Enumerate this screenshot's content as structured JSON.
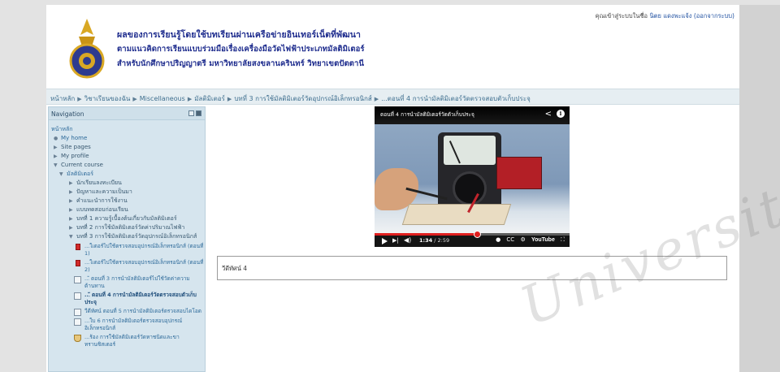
{
  "header": {
    "logo_label": "Prince of Songkla University",
    "title_line1": "ผลของการเรียนรู้โดยใช้บทเรียนผ่านเครือข่ายอินเทอร์เน็ตที่พัฒนา",
    "title_line2": "ตามแนวคิดการเรียนแบบร่วมมือเรื่องเครื่องมือวัดไฟฟ้าประเภทมัลติมิเตอร์",
    "title_line3": "สำหรับนักศึกษาปริญญาตรี มหาวิทยาลัยสงขลานครินทร์ วิทยาเขตปัตตานี",
    "login_prefix": "คุณเข้าสู่ระบบในชื่อ",
    "login_user": "นิตย แดงพะแจ้ง",
    "logout_label": "(ออกจากระบบ)"
  },
  "breadcrumb": {
    "items": [
      "หน้าหลัก",
      "วิชาเรียนของฉัน",
      "Miscellaneous",
      "มัลติมิเตอร์",
      "บทที่ 3 การใช้มัลติมิเตอร์วัดอุปกรณ์อิเล็กทรอนิกส์",
      "...ตอนที่ 4 การนำมัลติมิเตอร์วัดตรวจสอบตัวเก็บประจุ"
    ],
    "separator": "▶"
  },
  "sidebar": {
    "title": "Navigation",
    "home": "หน้าหลัก",
    "my_home": "My home",
    "site_pages": "Site pages",
    "my_profile": "My profile",
    "current_course": "Current course",
    "course_name": "มัลติมิเตอร์",
    "sections": [
      "นักเรียนลงทะเบียน",
      "ปัญหาและความเป็นมา",
      "คำแนะนำการใช้งาน",
      "แบบทดสอบก่อนเรียน",
      "บทที่ 1 ความรู้เบื้องต้นเกี่ยวกับมัลติมิเตอร์",
      "บทที่ 2 การใช้มัลติมิเตอร์วัดค่าปริมาณไฟฟ้า",
      "บทที่ 3 การใช้มัลติมิเตอร์วัดอุปกรณ์อิเล็กทรอนิกส์"
    ],
    "resources": [
      {
        "icon": "pdf-icon",
        "text": "...ใเตอร์ไปใช้ตรวจสอบอุปกรณ์อิเล็กทรอนิกส์ (ตอนที่ 1)",
        "bold": false
      },
      {
        "icon": "pdf-icon",
        "text": "...ใเตอร์ไปใช้ตรวจสอบอุปกรณ์อิเล็กทรอนิกส์ (ตอนที่ 2)",
        "bold": false
      },
      {
        "icon": "video-icon",
        "text": "...ั ตอนที่ 3 การนำมัลติมิเตอร์ไปใช้วัดค่าความต้านทาน",
        "bold": false
      },
      {
        "icon": "video-icon",
        "text": "...ั ตอนที่ 4 การนำมัลติมิเตอร์วัดตรวจสอบตัวเก็บประจุ",
        "bold": true
      },
      {
        "icon": "video-icon",
        "text": "วีดีทัศน์ ตอนที่ 5 การนำมัลติมิเตอร์ตรวจสอบไดโอด",
        "bold": false
      },
      {
        "icon": "file-icon",
        "text": "...ใบ 6 การนำมัลติมิเตอร์ตรวจสอบอุปกรณ์อิเล็กทรอนิกส์",
        "bold": false
      },
      {
        "icon": "quiz-icon",
        "text": "...ร้อง การใช้มัลติมิเตอร์วัดหาชนิดและขาทรานซิสเตอร์",
        "bold": false
      }
    ]
  },
  "video": {
    "title": "ตอนที่ 4 การนำมัลติมิเตอร์วัดตัวเก็บประจุ",
    "current_time": "1:34",
    "duration": "2:59",
    "progress": 0.525,
    "cc_label": "CC",
    "yt_label": "YouTube"
  },
  "caption": {
    "text": "วีดีทัศน์ 4"
  },
  "watermark": "University"
}
